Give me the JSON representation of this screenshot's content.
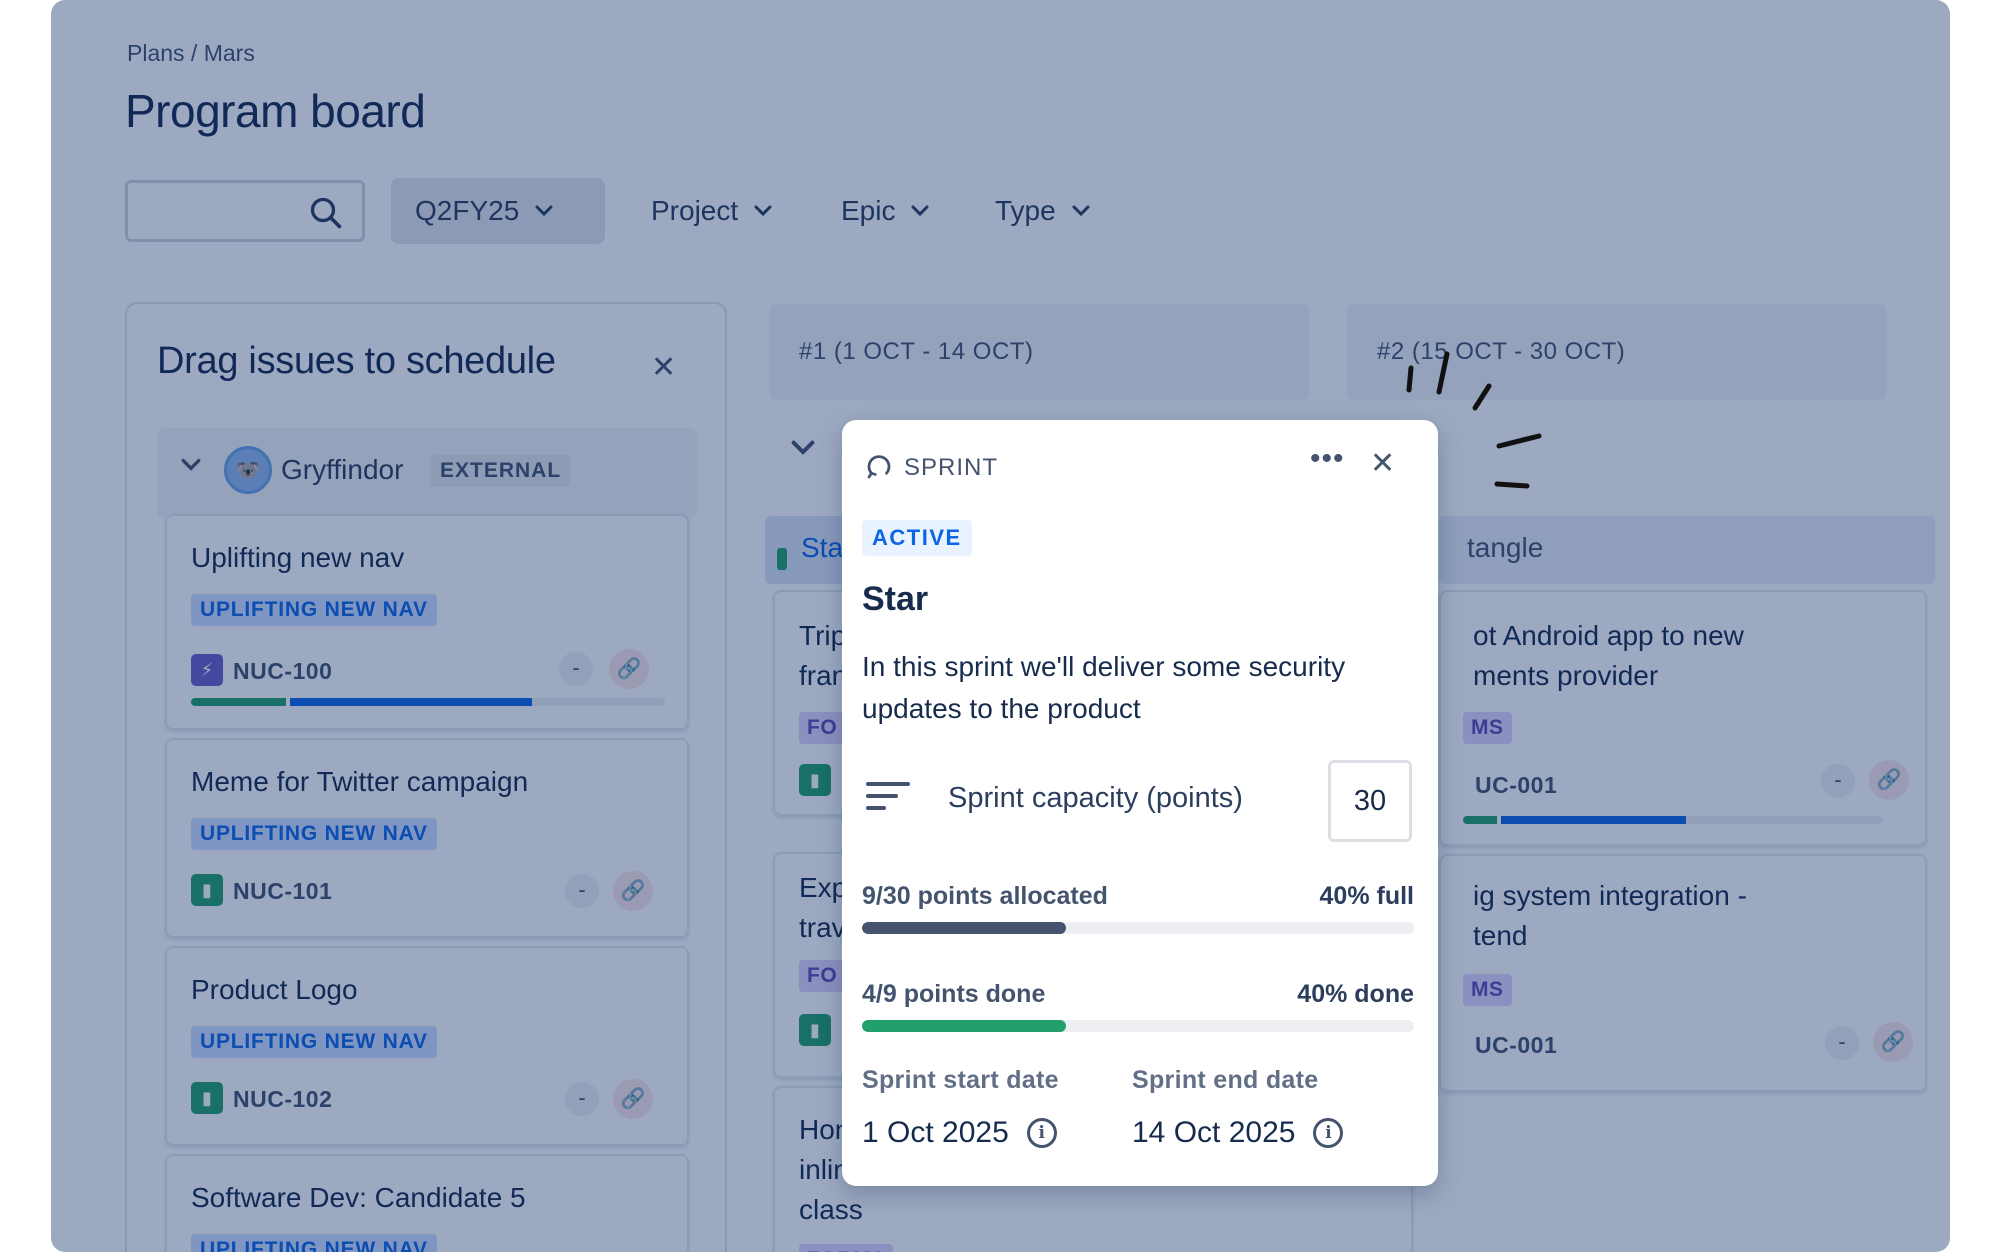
{
  "breadcrumb": "Plans / Mars",
  "page_title": "Program board",
  "search": {
    "value": "",
    "placeholder": ""
  },
  "filters": {
    "quarter": "Q2FY25",
    "project": "Project",
    "epic": "Epic",
    "type": "Type"
  },
  "backlog": {
    "title": "Drag issues to schedule",
    "close_label": "✕",
    "group": {
      "name": "Gryffindor",
      "badge": "EXTERNAL"
    },
    "cards": [
      {
        "title": "Uplifting new nav",
        "epic": "UPLIFTING NEW NAV",
        "key": "NUC-100",
        "type": "subtask",
        "done": 0.2,
        "inprogress": 0.52
      },
      {
        "title": "Meme for Twitter campaign",
        "epic": "UPLIFTING NEW NAV",
        "key": "NUC-101",
        "type": "story"
      },
      {
        "title": "Product Logo",
        "epic": "UPLIFTING NEW NAV",
        "key": "NUC-102",
        "type": "story"
      },
      {
        "title": "Software Dev: Candidate 5",
        "epic": "UPLIFTING NEW NAV"
      }
    ],
    "estimate_placeholder": "-"
  },
  "sprints": [
    {
      "header": "#1 (1 OCT - 14 OCT)"
    },
    {
      "header": "#2 (15 OCT - 30 OCT)"
    }
  ],
  "swimlanes": {
    "left_partial": "Sta",
    "right_partial": "tangle"
  },
  "middle_cards": [
    {
      "line1": "Trip",
      "line2": "fran",
      "tag": "FO"
    },
    {
      "line1": "Exp",
      "line2": "trav",
      "tag": "FO"
    },
    {
      "line1": "Hon",
      "line2": "inlin",
      "line3": "class",
      "tag": "FORMS"
    }
  ],
  "right_cards": [
    {
      "line1": "ot Android app to new",
      "line2": "ments provider",
      "tag": "MS",
      "key": "UC-001"
    },
    {
      "line1": "ig system integration -",
      "line2": "tend",
      "tag": "MS",
      "key": "UC-001"
    }
  ],
  "popup": {
    "kind": "SPRINT",
    "more": "•••",
    "close": "✕",
    "status": "ACTIVE",
    "name": "Star",
    "description": "In this sprint we'll deliver some security updates to the product",
    "capacity_label": "Sprint capacity (points)",
    "capacity_value": "30",
    "allocated_text": "9/30 points allocated",
    "allocated_pct_text": "40% full",
    "allocated_fraction": 0.37,
    "done_text": "4/9 points done",
    "done_pct_text": "40% done",
    "done_fraction": 0.37,
    "start_label": "Sprint start date",
    "start_value": "1 Oct 2025",
    "end_label": "Sprint end date",
    "end_value": "14 Oct 2025"
  },
  "colors": {
    "brand_blue": "#0c66e4",
    "success_green": "#22a06b",
    "subtask_purple": "#6e5dc6",
    "danger_red": "#c9372c",
    "bar_navy": "#44546f",
    "overlay": "rgba(9,40,100,0.40)"
  }
}
